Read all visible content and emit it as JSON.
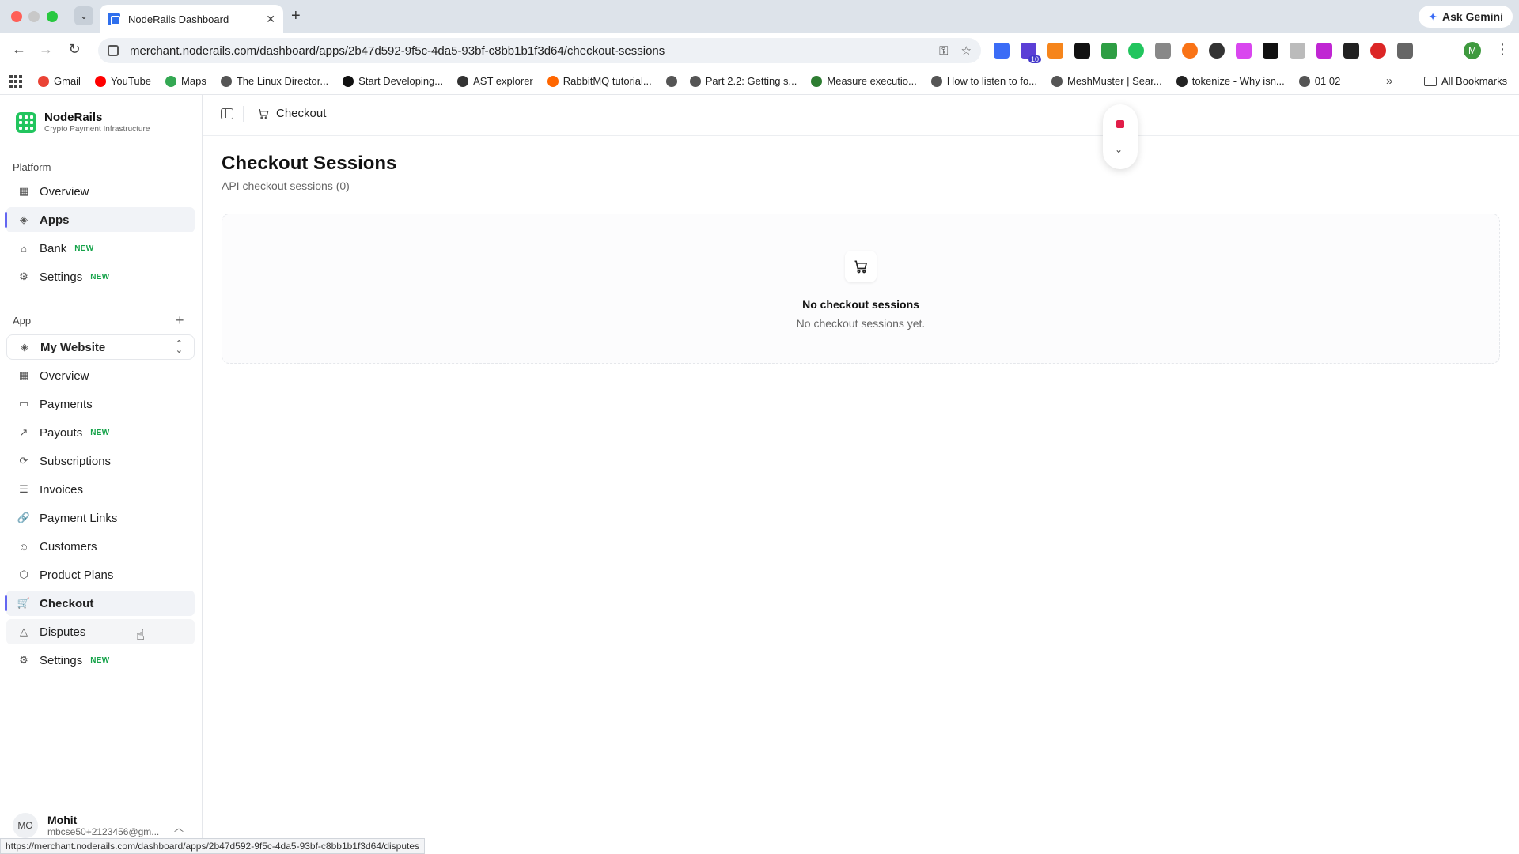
{
  "browser": {
    "tab_title": "NodeRails Dashboard",
    "ask_gemini": "Ask Gemini",
    "url": "merchant.noderails.com/dashboard/apps/2b47d592-9f5c-4da5-93bf-c8bb1b1f3d64/checkout-sessions",
    "profile_initial": "M",
    "extensions_badge": "10",
    "bookmarks": [
      {
        "label": "Gmail",
        "icon": "gmail-icon",
        "color": "#ea4335"
      },
      {
        "label": "YouTube",
        "icon": "youtube-icon",
        "color": "#ff0000"
      },
      {
        "label": "Maps",
        "icon": "maps-icon",
        "color": "#34a853"
      },
      {
        "label": "The Linux Director...",
        "icon": "globe-icon",
        "color": "#555555"
      },
      {
        "label": "Start Developing...",
        "icon": "medium-icon",
        "color": "#111111"
      },
      {
        "label": "AST explorer",
        "icon": "ast-icon",
        "color": "#333333"
      },
      {
        "label": "RabbitMQ tutorial...",
        "icon": "rabbitmq-icon",
        "color": "#ff6600"
      },
      {
        "label": "",
        "icon": "globe-icon",
        "color": "#555555"
      },
      {
        "label": "Part 2.2: Getting s...",
        "icon": "globe-icon",
        "color": "#555555"
      },
      {
        "label": "Measure executio...",
        "icon": "link-icon",
        "color": "#2e7d32"
      },
      {
        "label": "How to listen to fo...",
        "icon": "globe-icon",
        "color": "#555555"
      },
      {
        "label": "MeshMuster | Sear...",
        "icon": "globe-icon",
        "color": "#555555"
      },
      {
        "label": "tokenize - Why isn...",
        "icon": "stackoverflow-icon",
        "color": "#222222"
      },
      {
        "label": "01 02",
        "icon": "globe-icon",
        "color": "#555555"
      }
    ],
    "bookmarks_more": "»",
    "all_bookmarks": "All Bookmarks",
    "status_url": "https://merchant.noderails.com/dashboard/apps/2b47d592-9f5c-4da5-93bf-c8bb1b1f3d64/disputes"
  },
  "brand": {
    "name": "NodeRails",
    "tagline": "Crypto Payment Infrastructure",
    "color": "#22c55e"
  },
  "sidebar": {
    "platform_label": "Platform",
    "platform_items": [
      {
        "label": "Overview",
        "icon": "grid-icon",
        "badge": ""
      },
      {
        "label": "Apps",
        "icon": "layers-icon",
        "badge": ""
      },
      {
        "label": "Bank",
        "icon": "bank-icon",
        "badge": "NEW"
      },
      {
        "label": "Settings",
        "icon": "gear-icon",
        "badge": "NEW"
      }
    ],
    "app_label": "App",
    "add_app": "+",
    "current_app": "My Website",
    "app_items": [
      {
        "label": "Overview",
        "icon": "grid-icon",
        "badge": ""
      },
      {
        "label": "Payments",
        "icon": "card-icon",
        "badge": ""
      },
      {
        "label": "Payouts",
        "icon": "arrow-up-right-icon",
        "badge": "NEW"
      },
      {
        "label": "Subscriptions",
        "icon": "refresh-icon",
        "badge": ""
      },
      {
        "label": "Invoices",
        "icon": "list-icon",
        "badge": ""
      },
      {
        "label": "Payment Links",
        "icon": "link-icon",
        "badge": ""
      },
      {
        "label": "Customers",
        "icon": "users-icon",
        "badge": ""
      },
      {
        "label": "Product Plans",
        "icon": "box-icon",
        "badge": ""
      },
      {
        "label": "Checkout",
        "icon": "cart-icon",
        "badge": ""
      },
      {
        "label": "Disputes",
        "icon": "warning-icon",
        "badge": ""
      },
      {
        "label": "Settings",
        "icon": "gear-icon",
        "badge": "NEW"
      }
    ],
    "user": {
      "initials": "MO",
      "name": "Mohit",
      "email": "mbcse50+2123456@gm..."
    }
  },
  "header": {
    "breadcrumb": "Checkout"
  },
  "main": {
    "title": "Checkout Sessions",
    "subtitle": "API checkout sessions (0)",
    "empty_title": "No checkout sessions",
    "empty_desc": "No checkout sessions yet."
  },
  "colors": {
    "accent": "#6366f1",
    "new_badge": "#16a34a",
    "record": "#e11d48"
  }
}
